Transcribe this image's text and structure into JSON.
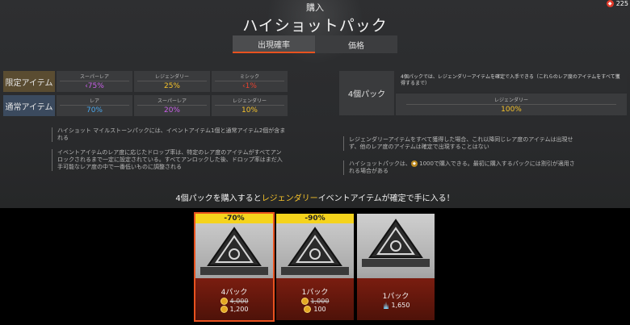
{
  "header": {
    "label": "購入",
    "title": "ハイショットパック"
  },
  "currency": {
    "icon": "apex-coin-icon",
    "value": "225"
  },
  "tabs": [
    {
      "label": "出現確率",
      "active": true
    },
    {
      "label": "価格",
      "active": false
    }
  ],
  "rarity_table": {
    "rows": [
      {
        "label": "限定アイテム",
        "cells": [
          {
            "tier": "スーパーレア",
            "value": "‹75%",
            "color": "#c860e8"
          },
          {
            "tier": "レジェンダリー",
            "value": "25%",
            "color": "#f6c32b"
          },
          {
            "tier": "ミシック",
            "value": "‹1%",
            "color": "#e8412f"
          }
        ]
      },
      {
        "label": "通常アイテム",
        "cells": [
          {
            "tier": "レア",
            "value": "70%",
            "color": "#4aa8ef"
          },
          {
            "tier": "スーパーレア",
            "value": "20%",
            "color": "#c860e8"
          },
          {
            "tier": "レジェンダリー",
            "value": "10%",
            "color": "#f6c32b"
          }
        ]
      }
    ]
  },
  "four_pack": {
    "label": "4個パック",
    "description": "4個パックでは、レジェンダリーアイテムを確定で入手できる（これらのレア度のアイテムをすべて獲得するまで）",
    "tier": "レジェンダリー",
    "value": "100%"
  },
  "notes_left": [
    "ハイショット マイルストーンパックには、イベントアイテム1個と通常アイテム2個が含まれる",
    "イベントアイテムのレア度に応じたドロップ率は、特定のレア度のアイテムがすべてアンロックされるまで一定に設定されている。すべてアンロックした後、ドロップ率はまだ入手可能なレア度の中で一番低いものに調整される"
  ],
  "notes_right": [
    "レジェンダリーアイテムをすべて獲得した場合、これ以降同じレア度のアイテムは出現せず、他のレア度のアイテムは確定で出現することはない",
    {
      "before": "ハイショットパックは、",
      "price": "1000",
      "after": "で購入できる。最初に購入するパックには割引が適用される場合がある"
    }
  ],
  "promo": {
    "before": "4個パックを購入すると",
    "highlight": "レジェンダリー",
    "after": "イベントアイテムが確定で手に入る！"
  },
  "packs": [
    {
      "discount": "-70%",
      "name": "4パック",
      "old_price": "4,000",
      "price": "1,200",
      "currency_icon": "apex-coin-icon",
      "selected": true
    },
    {
      "discount": "-90%",
      "name": "1パック",
      "old_price": "1,000",
      "price": "100",
      "currency_icon": "apex-coin-icon",
      "selected": false
    },
    {
      "discount": "",
      "name": "1パック",
      "old_price": "",
      "price": "1,650",
      "currency_icon": "crafting-metals-icon",
      "selected": false
    }
  ]
}
